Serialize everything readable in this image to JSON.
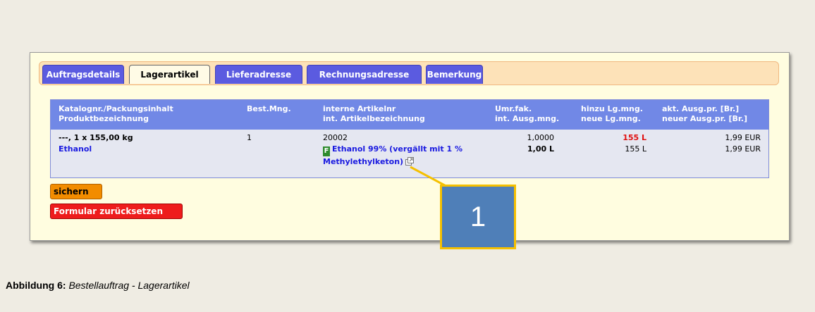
{
  "tabs": [
    {
      "label": "Auftragsdetails",
      "active": false
    },
    {
      "label": "Lagerartikel",
      "active": true
    },
    {
      "label": "Lieferadresse",
      "active": false
    },
    {
      "label": "Rechnungsadresse",
      "active": false
    },
    {
      "label": "Bemerkung",
      "active": false
    }
  ],
  "table": {
    "headers": {
      "col1": [
        "Katalognr./Packungsinhalt",
        "Produktbezeichnung"
      ],
      "col2": [
        "Best.Mng."
      ],
      "col3": [
        "interne Artikelnr",
        "int. Artikelbezeichnung"
      ],
      "col4": [
        "Umr.fak.",
        "int. Ausg.mng."
      ],
      "col5": [
        "hinzu Lg.mng.",
        "neue Lg.mng."
      ],
      "col6": [
        "akt. Ausg.pr. [Br.]",
        "neuer Ausg.pr. [Br.]"
      ]
    },
    "row": {
      "catalog_packing": "---, 1 x 155,00 kg",
      "product_name": "Ethanol",
      "order_qty": "1",
      "internal_article_no": "20002",
      "badge": "F",
      "internal_article_name_line1": "Ethanol 99% (vergällt mit 1 %",
      "internal_article_name_line2": "Methylethylketon)",
      "conversion_factor": "1,0000",
      "internal_issue_qty": "1,00 L",
      "add_stock_qty": "155 L",
      "new_stock_qty": "155 L",
      "current_issue_price": "1,99 EUR",
      "new_issue_price": "1,99 EUR"
    }
  },
  "buttons": {
    "save": "sichern",
    "reset": "Formular zurücksetzen"
  },
  "callout": {
    "number": "1"
  },
  "caption": {
    "label": "Abbildung 6:",
    "text": "Bestellauftrag - Lagerartikel"
  },
  "colors": {
    "tab_inactive": "#5b5be0",
    "header_bg": "#7188e6",
    "save_button": "#f28c00",
    "reset_button": "#ee1c1c",
    "callout_bg": "#4f7fb8",
    "callout_border": "#f5c000"
  },
  "icons": {
    "external_link": "external-link-icon"
  }
}
